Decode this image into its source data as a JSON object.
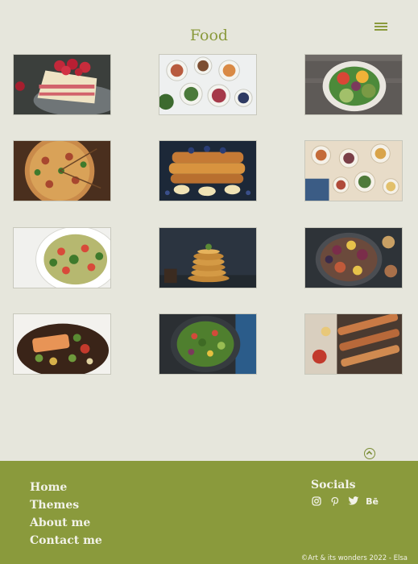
{
  "header": {
    "title": "Food",
    "menu_icon": "hamburger-menu-icon"
  },
  "gallery": {
    "images": [
      {
        "subject": "strawberry-cake"
      },
      {
        "subject": "breakfast-bowls"
      },
      {
        "subject": "salad-bowl"
      },
      {
        "subject": "pizza"
      },
      {
        "subject": "french-toast"
      },
      {
        "subject": "brunch-table"
      },
      {
        "subject": "pasta-salad"
      },
      {
        "subject": "pancakes"
      },
      {
        "subject": "figs-platter"
      },
      {
        "subject": "salmon-plate"
      },
      {
        "subject": "green-salad"
      },
      {
        "subject": "skewers"
      }
    ]
  },
  "scroll_top_icon": "chevron-up-circle-icon",
  "footer": {
    "nav": [
      "Home",
      "Themes",
      "About me",
      "Contact me"
    ],
    "socials_title": "Socials",
    "socials": [
      {
        "icon": "instagram-icon"
      },
      {
        "icon": "pinterest-icon"
      },
      {
        "icon": "twitter-icon"
      },
      {
        "icon": "behance-icon",
        "label": "Bē"
      }
    ],
    "copyright": "©Art & its wonders 2022 - Elsa"
  },
  "colors": {
    "background": "#e6e6dc",
    "accent": "#8a9a3c",
    "footer_text": "#f2f2e8"
  }
}
